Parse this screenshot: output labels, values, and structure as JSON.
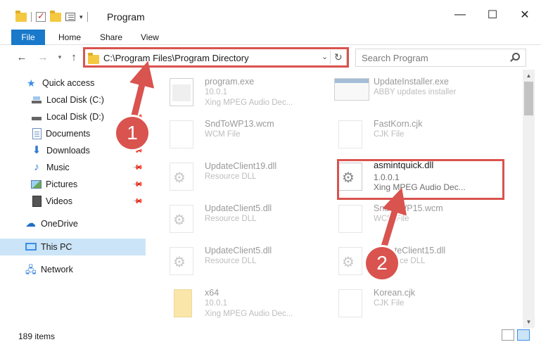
{
  "window": {
    "title": "Program",
    "minimize": "—",
    "maximize": "☐",
    "close": "✕"
  },
  "ribbon": {
    "tabs": [
      "File",
      "Home",
      "Share",
      "View"
    ]
  },
  "nav": {
    "back": "←",
    "forward": "→",
    "recent": "▾",
    "up": "↑",
    "address": "C:\\Program Files\\Program Directory",
    "address_dropdown": "⌄",
    "refresh": "↻",
    "search_placeholder": "Search Program"
  },
  "sidebar": {
    "items": [
      {
        "label": "Quick access",
        "icon": "quick-access-icon",
        "pinned": false
      },
      {
        "label": "Local Disk (C:)",
        "icon": "local-disk-icon",
        "pinned": false
      },
      {
        "label": "Local Disk (D:)",
        "icon": "local-disk-icon",
        "pinned": true
      },
      {
        "label": "Documents",
        "icon": "documents-icon",
        "pinned": true
      },
      {
        "label": "Downloads",
        "icon": "downloads-icon",
        "pinned": true
      },
      {
        "label": "Music",
        "icon": "music-icon",
        "pinned": true
      },
      {
        "label": "Pictures",
        "icon": "pictures-icon",
        "pinned": true
      },
      {
        "label": "Videos",
        "icon": "videos-icon",
        "pinned": true
      },
      {
        "label": "OneDrive",
        "icon": "onedrive-icon",
        "pinned": false
      },
      {
        "label": "This PC",
        "icon": "this-pc-icon",
        "pinned": false,
        "selected": true
      },
      {
        "label": "Network",
        "icon": "network-icon",
        "pinned": false
      }
    ]
  },
  "files": [
    {
      "name": "program.exe",
      "line2": "10.0.1",
      "line3": "Xing MPEG Audio Dec...",
      "icon": "exe-icon"
    },
    {
      "name": "UpdateInstaller.exe",
      "line2": "ABBY updates installer",
      "line3": "",
      "icon": "installer-icon"
    },
    {
      "name": "SndToWP13.wcm",
      "line2": "WCM File",
      "line3": "",
      "icon": "file-icon"
    },
    {
      "name": "FastKorn.cjk",
      "line2": "CJK File",
      "line3": "",
      "icon": "file-icon"
    },
    {
      "name": "UpdateClient19.dll",
      "line2": "Resource DLL",
      "line3": "",
      "icon": "dll-icon"
    },
    {
      "name": "asmintquick.dll",
      "line2": "1.0.0.1",
      "line3": "Xing MPEG Audio Dec...",
      "icon": "dll-icon"
    },
    {
      "name": "UpdateClient5.dll",
      "line2": "Resource DLL",
      "line3": "",
      "icon": "dll-icon"
    },
    {
      "name": "SndToWP15.wcm",
      "line2": "WCM File",
      "line3": "",
      "icon": "file-icon"
    },
    {
      "name": "UpdateClient5.dll",
      "line2": "Resource DLL",
      "line3": "",
      "icon": "dll-icon"
    },
    {
      "name": "UpdateClient15.dll",
      "line2": "Resource DLL",
      "line3": "",
      "icon": "dll-icon"
    },
    {
      "name": "x64",
      "line2": "10.0.1",
      "line3": "Xing MPEG Audio Dec...",
      "icon": "folder-icon"
    },
    {
      "name": "Korean.cjk",
      "line2": "CJK File",
      "line3": "",
      "icon": "file-icon"
    }
  ],
  "status": {
    "items_count": "189 items"
  },
  "annotations": {
    "badge1": "1",
    "badge2": "2",
    "highlight_color": "#d9534f"
  }
}
